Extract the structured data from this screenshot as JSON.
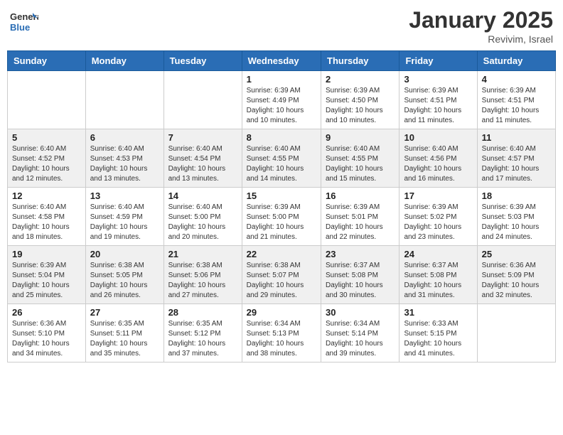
{
  "header": {
    "logo_general": "General",
    "logo_blue": "Blue",
    "month_year": "January 2025",
    "location": "Revivim, Israel"
  },
  "days_of_week": [
    "Sunday",
    "Monday",
    "Tuesday",
    "Wednesday",
    "Thursday",
    "Friday",
    "Saturday"
  ],
  "weeks": [
    [
      {
        "day": "",
        "sunrise": "",
        "sunset": "",
        "daylight": ""
      },
      {
        "day": "",
        "sunrise": "",
        "sunset": "",
        "daylight": ""
      },
      {
        "day": "",
        "sunrise": "",
        "sunset": "",
        "daylight": ""
      },
      {
        "day": "1",
        "sunrise": "Sunrise: 6:39 AM",
        "sunset": "Sunset: 4:49 PM",
        "daylight": "Daylight: 10 hours and 10 minutes."
      },
      {
        "day": "2",
        "sunrise": "Sunrise: 6:39 AM",
        "sunset": "Sunset: 4:50 PM",
        "daylight": "Daylight: 10 hours and 10 minutes."
      },
      {
        "day": "3",
        "sunrise": "Sunrise: 6:39 AM",
        "sunset": "Sunset: 4:51 PM",
        "daylight": "Daylight: 10 hours and 11 minutes."
      },
      {
        "day": "4",
        "sunrise": "Sunrise: 6:39 AM",
        "sunset": "Sunset: 4:51 PM",
        "daylight": "Daylight: 10 hours and 11 minutes."
      }
    ],
    [
      {
        "day": "5",
        "sunrise": "Sunrise: 6:40 AM",
        "sunset": "Sunset: 4:52 PM",
        "daylight": "Daylight: 10 hours and 12 minutes."
      },
      {
        "day": "6",
        "sunrise": "Sunrise: 6:40 AM",
        "sunset": "Sunset: 4:53 PM",
        "daylight": "Daylight: 10 hours and 13 minutes."
      },
      {
        "day": "7",
        "sunrise": "Sunrise: 6:40 AM",
        "sunset": "Sunset: 4:54 PM",
        "daylight": "Daylight: 10 hours and 13 minutes."
      },
      {
        "day": "8",
        "sunrise": "Sunrise: 6:40 AM",
        "sunset": "Sunset: 4:55 PM",
        "daylight": "Daylight: 10 hours and 14 minutes."
      },
      {
        "day": "9",
        "sunrise": "Sunrise: 6:40 AM",
        "sunset": "Sunset: 4:55 PM",
        "daylight": "Daylight: 10 hours and 15 minutes."
      },
      {
        "day": "10",
        "sunrise": "Sunrise: 6:40 AM",
        "sunset": "Sunset: 4:56 PM",
        "daylight": "Daylight: 10 hours and 16 minutes."
      },
      {
        "day": "11",
        "sunrise": "Sunrise: 6:40 AM",
        "sunset": "Sunset: 4:57 PM",
        "daylight": "Daylight: 10 hours and 17 minutes."
      }
    ],
    [
      {
        "day": "12",
        "sunrise": "Sunrise: 6:40 AM",
        "sunset": "Sunset: 4:58 PM",
        "daylight": "Daylight: 10 hours and 18 minutes."
      },
      {
        "day": "13",
        "sunrise": "Sunrise: 6:40 AM",
        "sunset": "Sunset: 4:59 PM",
        "daylight": "Daylight: 10 hours and 19 minutes."
      },
      {
        "day": "14",
        "sunrise": "Sunrise: 6:40 AM",
        "sunset": "Sunset: 5:00 PM",
        "daylight": "Daylight: 10 hours and 20 minutes."
      },
      {
        "day": "15",
        "sunrise": "Sunrise: 6:39 AM",
        "sunset": "Sunset: 5:00 PM",
        "daylight": "Daylight: 10 hours and 21 minutes."
      },
      {
        "day": "16",
        "sunrise": "Sunrise: 6:39 AM",
        "sunset": "Sunset: 5:01 PM",
        "daylight": "Daylight: 10 hours and 22 minutes."
      },
      {
        "day": "17",
        "sunrise": "Sunrise: 6:39 AM",
        "sunset": "Sunset: 5:02 PM",
        "daylight": "Daylight: 10 hours and 23 minutes."
      },
      {
        "day": "18",
        "sunrise": "Sunrise: 6:39 AM",
        "sunset": "Sunset: 5:03 PM",
        "daylight": "Daylight: 10 hours and 24 minutes."
      }
    ],
    [
      {
        "day": "19",
        "sunrise": "Sunrise: 6:39 AM",
        "sunset": "Sunset: 5:04 PM",
        "daylight": "Daylight: 10 hours and 25 minutes."
      },
      {
        "day": "20",
        "sunrise": "Sunrise: 6:38 AM",
        "sunset": "Sunset: 5:05 PM",
        "daylight": "Daylight: 10 hours and 26 minutes."
      },
      {
        "day": "21",
        "sunrise": "Sunrise: 6:38 AM",
        "sunset": "Sunset: 5:06 PM",
        "daylight": "Daylight: 10 hours and 27 minutes."
      },
      {
        "day": "22",
        "sunrise": "Sunrise: 6:38 AM",
        "sunset": "Sunset: 5:07 PM",
        "daylight": "Daylight: 10 hours and 29 minutes."
      },
      {
        "day": "23",
        "sunrise": "Sunrise: 6:37 AM",
        "sunset": "Sunset: 5:08 PM",
        "daylight": "Daylight: 10 hours and 30 minutes."
      },
      {
        "day": "24",
        "sunrise": "Sunrise: 6:37 AM",
        "sunset": "Sunset: 5:08 PM",
        "daylight": "Daylight: 10 hours and 31 minutes."
      },
      {
        "day": "25",
        "sunrise": "Sunrise: 6:36 AM",
        "sunset": "Sunset: 5:09 PM",
        "daylight": "Daylight: 10 hours and 32 minutes."
      }
    ],
    [
      {
        "day": "26",
        "sunrise": "Sunrise: 6:36 AM",
        "sunset": "Sunset: 5:10 PM",
        "daylight": "Daylight: 10 hours and 34 minutes."
      },
      {
        "day": "27",
        "sunrise": "Sunrise: 6:35 AM",
        "sunset": "Sunset: 5:11 PM",
        "daylight": "Daylight: 10 hours and 35 minutes."
      },
      {
        "day": "28",
        "sunrise": "Sunrise: 6:35 AM",
        "sunset": "Sunset: 5:12 PM",
        "daylight": "Daylight: 10 hours and 37 minutes."
      },
      {
        "day": "29",
        "sunrise": "Sunrise: 6:34 AM",
        "sunset": "Sunset: 5:13 PM",
        "daylight": "Daylight: 10 hours and 38 minutes."
      },
      {
        "day": "30",
        "sunrise": "Sunrise: 6:34 AM",
        "sunset": "Sunset: 5:14 PM",
        "daylight": "Daylight: 10 hours and 39 minutes."
      },
      {
        "day": "31",
        "sunrise": "Sunrise: 6:33 AM",
        "sunset": "Sunset: 5:15 PM",
        "daylight": "Daylight: 10 hours and 41 minutes."
      },
      {
        "day": "",
        "sunrise": "",
        "sunset": "",
        "daylight": ""
      }
    ]
  ]
}
